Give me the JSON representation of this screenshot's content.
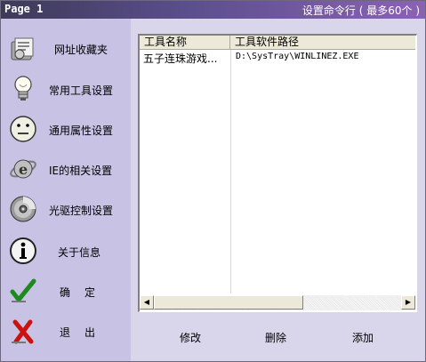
{
  "titlebar": {
    "page_label": "Page 1",
    "title": "设置命令行 ( 最多60个 )"
  },
  "sidebar": {
    "items": [
      {
        "label": "网址收藏夹",
        "icon": "folder-document-icon"
      },
      {
        "label": "常用工具设置",
        "icon": "lightbulb-icon"
      },
      {
        "label": "通用属性设置",
        "icon": "smiley-face-icon"
      },
      {
        "label": "IE的相关设置",
        "icon": "internet-explorer-icon"
      },
      {
        "label": "光驱控制设置",
        "icon": "cd-disc-icon"
      },
      {
        "label": "关于信息",
        "icon": "info-icon"
      },
      {
        "label": "确　定",
        "icon": "checkmark-icon"
      },
      {
        "label": "退　出",
        "icon": "x-cross-icon"
      }
    ]
  },
  "tool_list": {
    "columns": [
      "工具名称",
      "工具软件路径"
    ],
    "rows": [
      {
        "name": "五子连珠游戏...",
        "path": "D:\\SysTray\\WINLINEZ.EXE"
      }
    ]
  },
  "actions": {
    "modify": "修改",
    "delete": "删除",
    "add": "添加"
  },
  "colors": {
    "sidebar_bg": "#c8c2e4",
    "panel_bg": "#d9d5ea",
    "titlebar_start": "#3d3a58",
    "titlebar_end": "#8b62b3"
  }
}
